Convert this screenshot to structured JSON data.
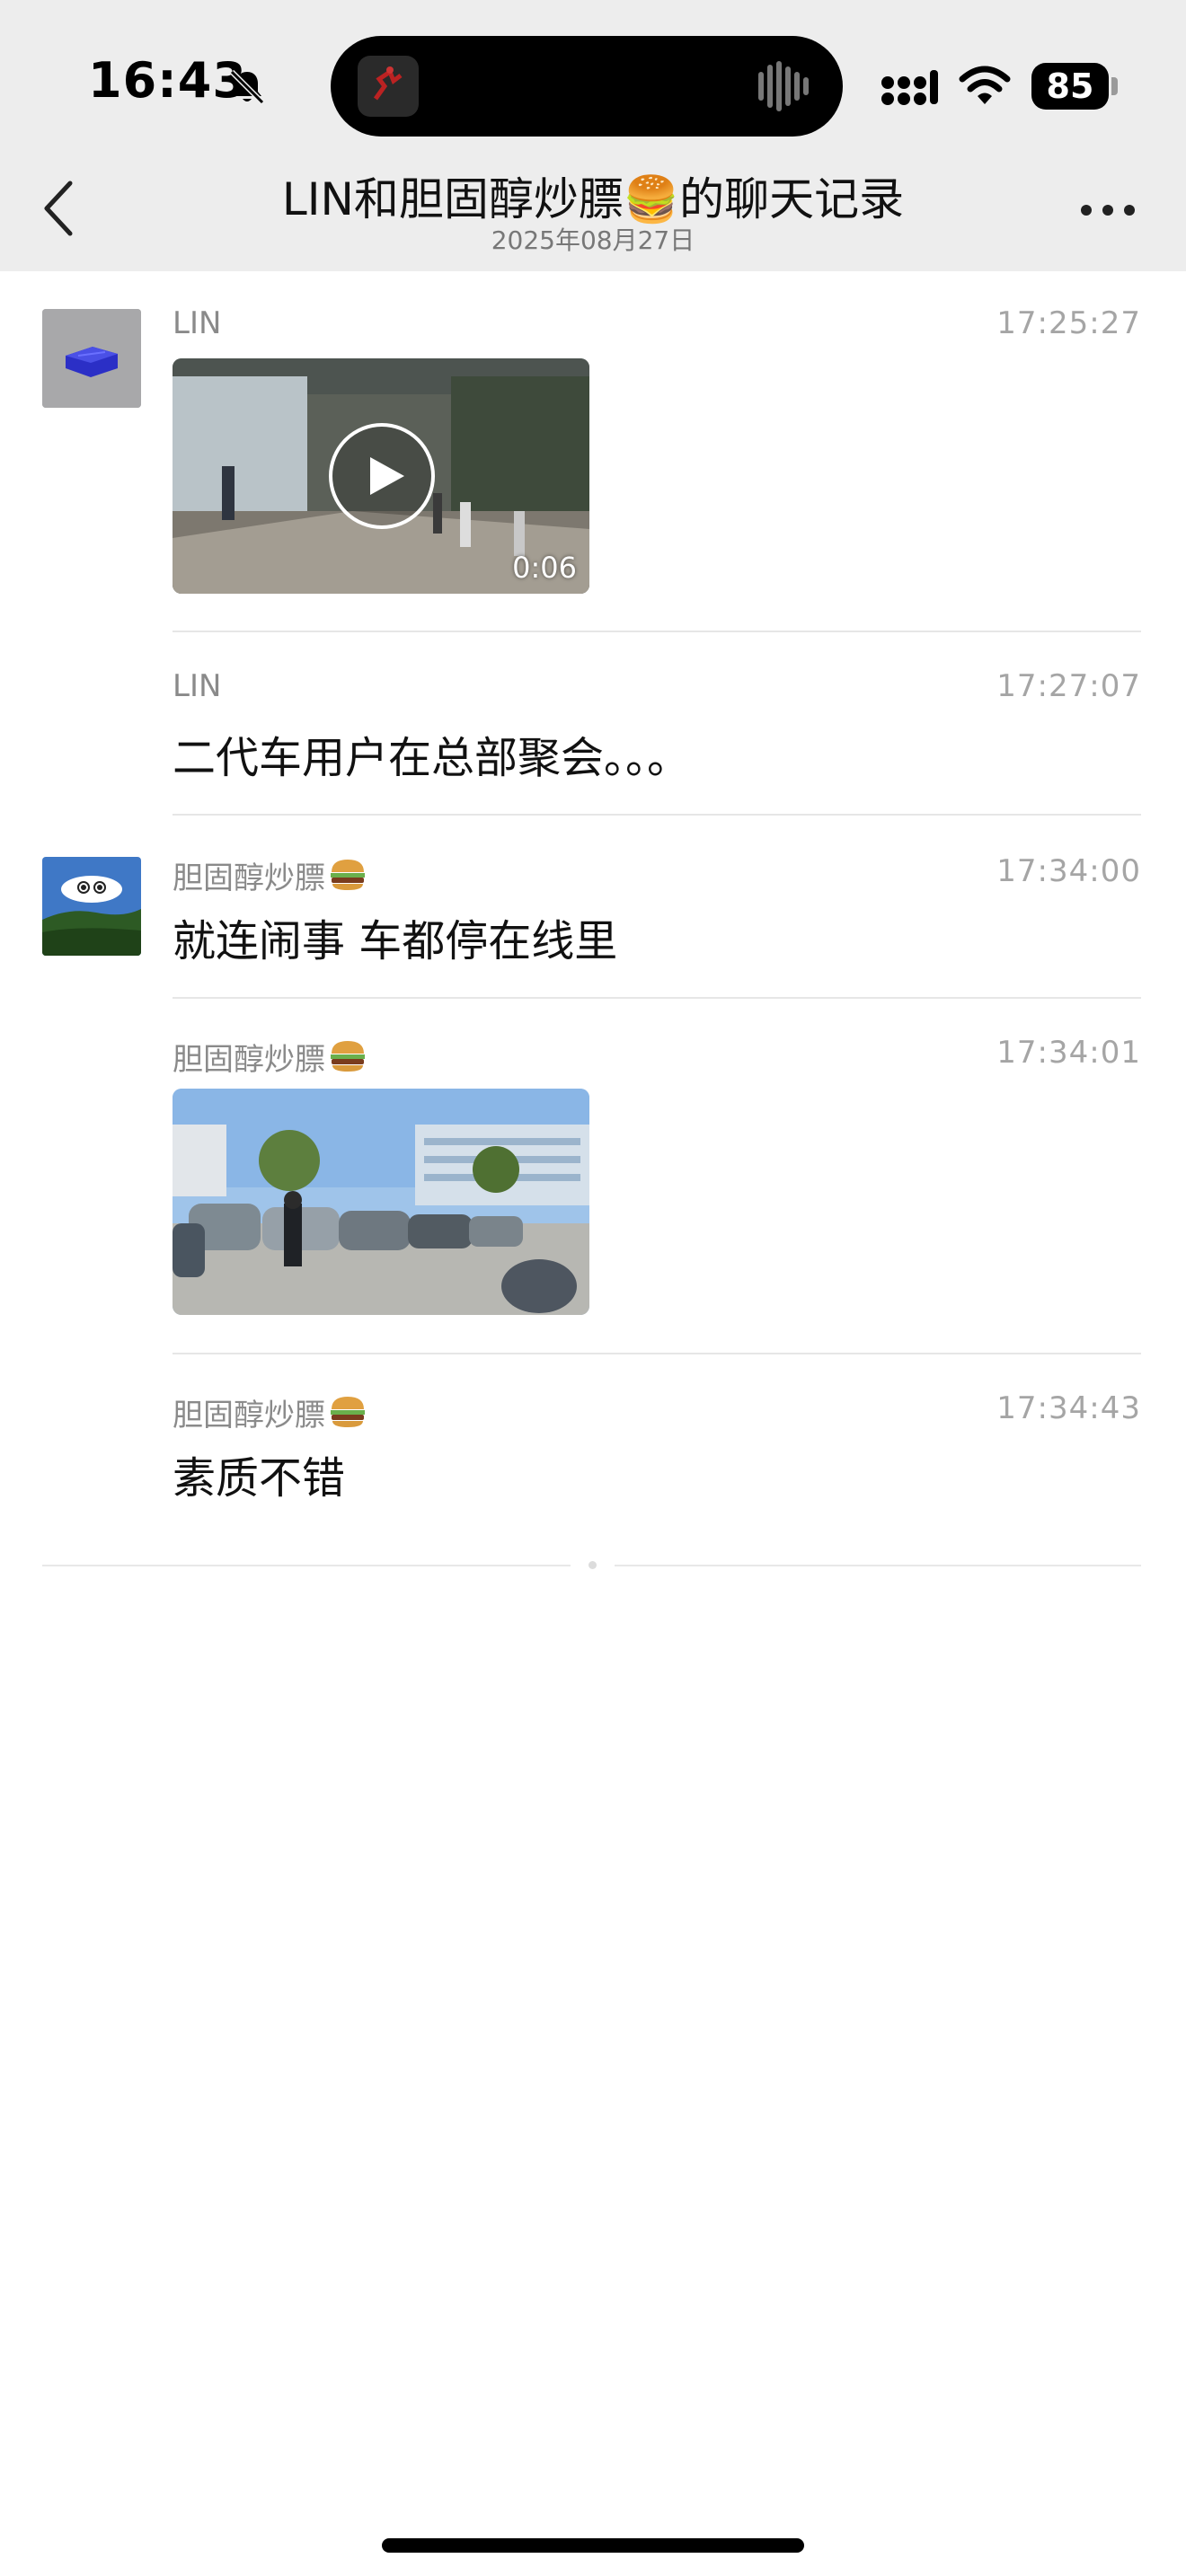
{
  "status_bar": {
    "time": "16:43",
    "battery": "85",
    "icons": [
      "bell-off-icon",
      "signal-icon",
      "wifi-icon",
      "battery-icon"
    ]
  },
  "header": {
    "title": "LIN和胆固醇炒膘🍔的聊天记录",
    "subtitle": "2025年08月27日",
    "icons": [
      "back-icon",
      "more-icon"
    ]
  },
  "messages": [
    {
      "sender": "LIN",
      "time": "17:25:27",
      "type": "video",
      "duration": "0:06"
    },
    {
      "sender": "LIN",
      "time": "17:27:07",
      "type": "text",
      "text": "二代车用户在总部聚会。。。"
    },
    {
      "sender": "胆固醇炒膘",
      "time": "17:34:00",
      "type": "text",
      "text": "就连闹事 车都停在线里"
    },
    {
      "sender": "胆固醇炒膘",
      "time": "17:34:01",
      "type": "image"
    },
    {
      "sender": "胆固醇炒膘",
      "time": "17:34:43",
      "type": "text",
      "text": "素质不错"
    }
  ],
  "colors": {
    "header_bg": "#ededed",
    "page_bg": "#ffffff",
    "sender_text": "#8a8a8a",
    "timestamp_text": "#a5a5a5"
  }
}
